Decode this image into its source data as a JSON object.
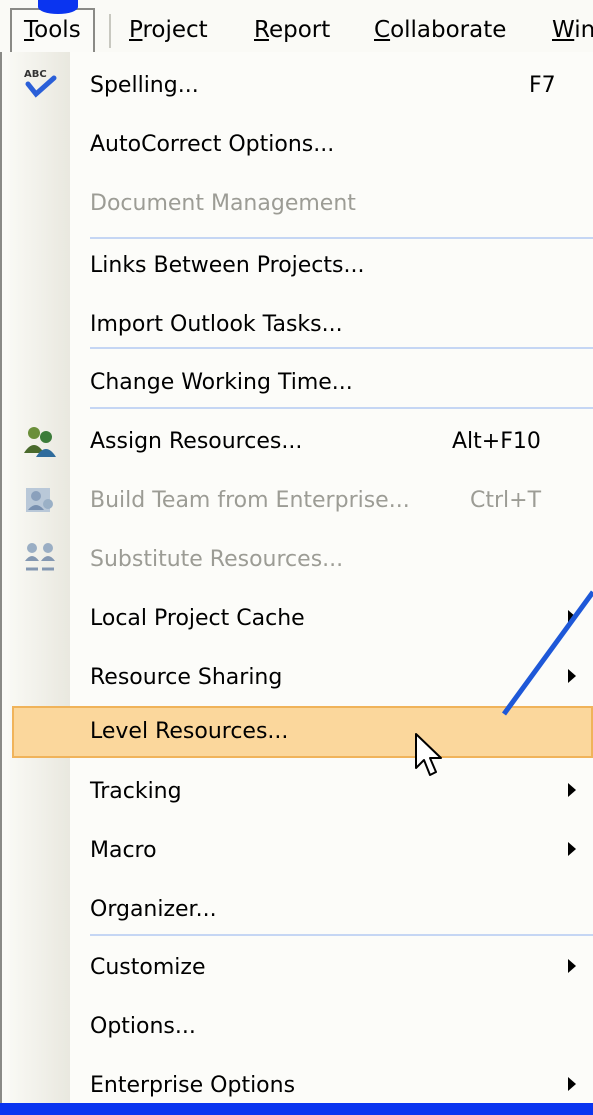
{
  "menubar": {
    "items": [
      {
        "label": "Tools",
        "open": true
      },
      {
        "label": "Project"
      },
      {
        "label": "Report"
      },
      {
        "label": "Collaborate"
      },
      {
        "label": "Win"
      }
    ]
  },
  "menu": {
    "items": [
      {
        "label": "Spelling...",
        "shortcut": "F7",
        "icon": "spelling-check-icon"
      },
      {
        "label": "AutoCorrect Options..."
      },
      {
        "label": "Document Management",
        "disabled": true
      },
      {
        "label": "Links Between Projects..."
      },
      {
        "label": "Import Outlook Tasks..."
      },
      {
        "label": "Change Working Time..."
      },
      {
        "label": "Assign Resources...",
        "shortcut": "Alt+F10",
        "icon": "assign-resources-icon"
      },
      {
        "label": "Build Team from Enterprise...",
        "shortcut": "Ctrl+T",
        "disabled": true,
        "icon": "build-team-icon"
      },
      {
        "label": "Substitute Resources...",
        "disabled": true,
        "icon": "substitute-resources-icon"
      },
      {
        "label": "Local Project Cache",
        "submenu": true
      },
      {
        "label": "Resource Sharing",
        "submenu": true
      },
      {
        "label": "Level Resources...",
        "highlighted": true
      },
      {
        "label": "Tracking",
        "submenu": true
      },
      {
        "label": "Macro",
        "submenu": true
      },
      {
        "label": "Organizer..."
      },
      {
        "label": "Customize",
        "submenu": true
      },
      {
        "label": "Options..."
      },
      {
        "label": "Enterprise Options",
        "submenu": true
      }
    ]
  },
  "colors": {
    "background_blue": "#0a34f0",
    "highlight_fill": "#fbd79c",
    "highlight_border": "#f0b35a",
    "disabled_text": "#9c9c95",
    "separator": "#c5d6f4"
  }
}
